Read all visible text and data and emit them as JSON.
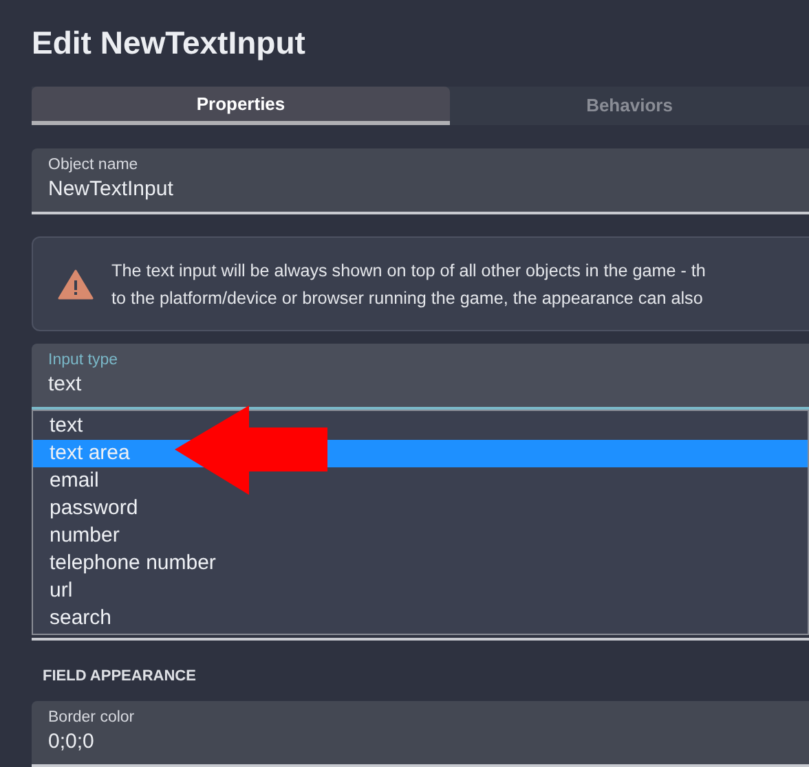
{
  "dialog": {
    "title": "Edit NewTextInput"
  },
  "tabs": [
    {
      "label": "Properties",
      "selected": true
    },
    {
      "label": "Behaviors",
      "selected": false
    }
  ],
  "object_name": {
    "label": "Object name",
    "value": "NewTextInput"
  },
  "warning": {
    "lines": [
      "The text input will be always shown on top of all other objects in the game - th",
      "to the platform/device or browser running the game, the appearance can also"
    ]
  },
  "input_type": {
    "label": "Input type",
    "value": "text",
    "expanded": true,
    "options": [
      {
        "label": "text",
        "highlighted": false
      },
      {
        "label": "text area",
        "highlighted": true
      },
      {
        "label": "email",
        "highlighted": false
      },
      {
        "label": "password",
        "highlighted": false
      },
      {
        "label": "number",
        "highlighted": false
      },
      {
        "label": "telephone number",
        "highlighted": false
      },
      {
        "label": "url",
        "highlighted": false
      },
      {
        "label": "search",
        "highlighted": false
      }
    ]
  },
  "section": {
    "title": "FIELD APPEARANCE"
  },
  "border_color": {
    "label": "Border color",
    "value": "0;0;0"
  }
}
